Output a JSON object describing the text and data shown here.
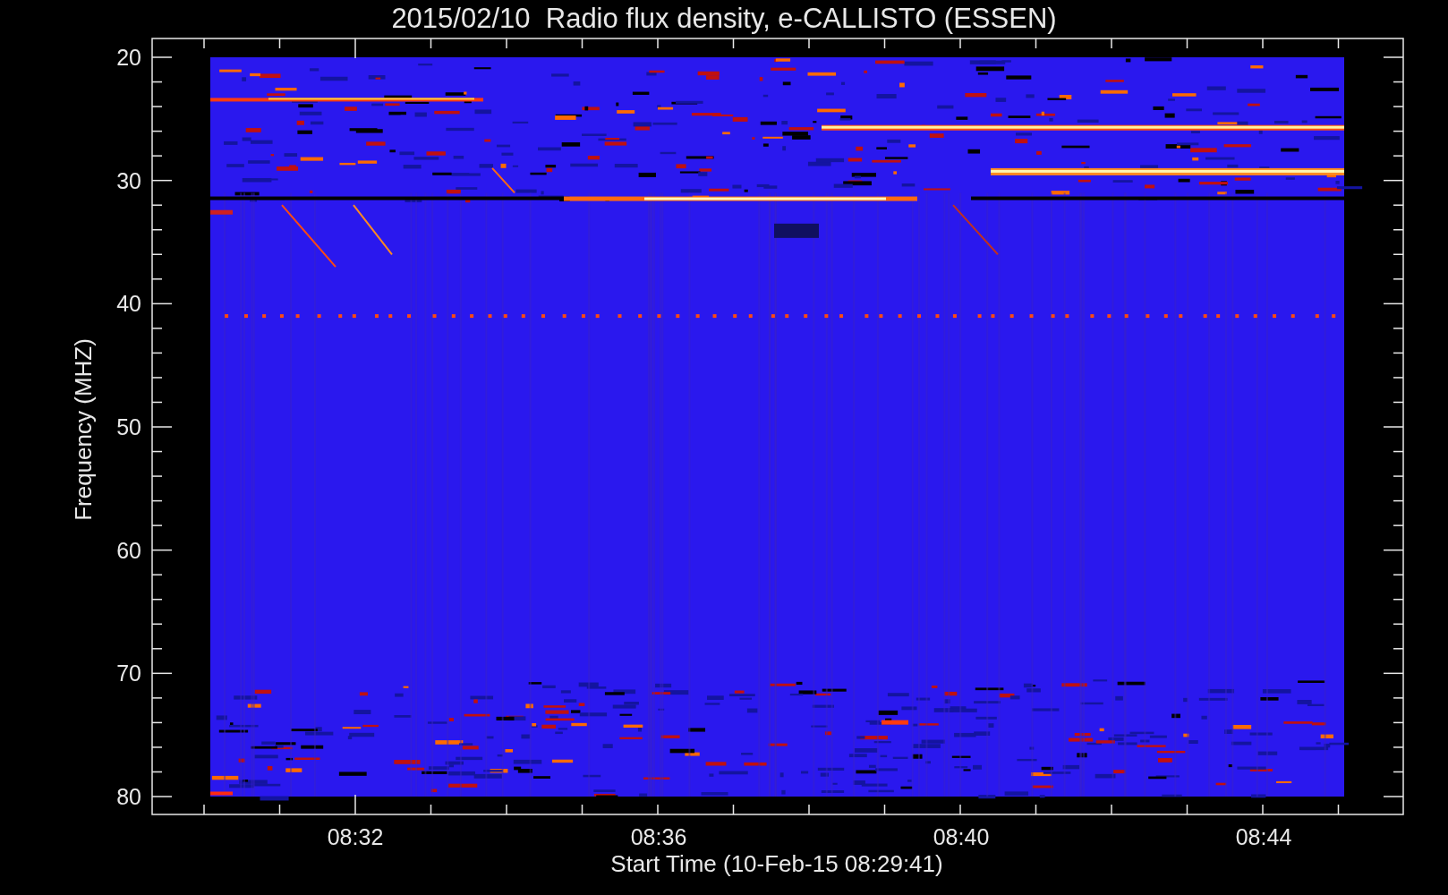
{
  "title": "2015/02/10  Radio flux density, e-CALLISTO (ESSEN)",
  "y_axis": {
    "label": "Frequency (MHZ)",
    "ticks": [
      "20",
      "30",
      "40",
      "50",
      "60",
      "70",
      "80"
    ]
  },
  "x_axis": {
    "label": "Start Time (10-Feb-15 08:29:41)",
    "ticks": [
      "08:32",
      "08:36",
      "08:40",
      "08:44"
    ]
  }
}
